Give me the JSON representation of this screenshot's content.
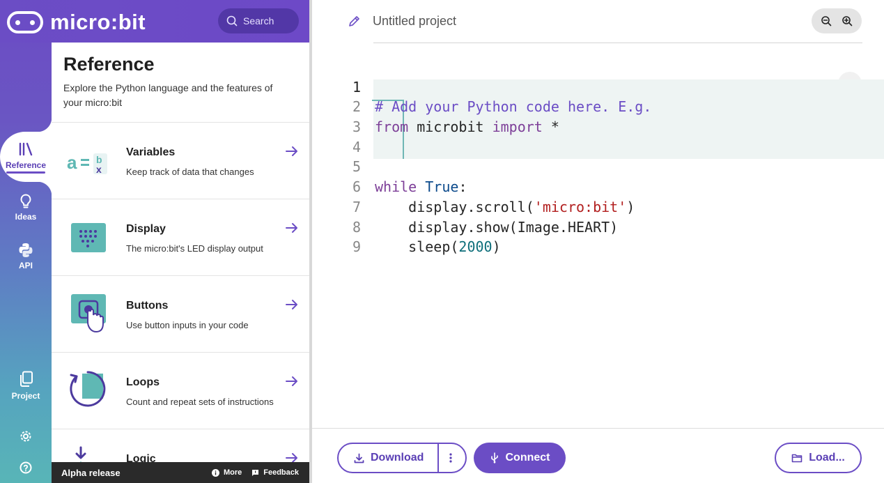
{
  "app": {
    "brand": "micro:bit"
  },
  "search": {
    "label": "Search"
  },
  "nav": {
    "items": [
      {
        "label": "Reference",
        "icon": "library-icon",
        "active": true
      },
      {
        "label": "Ideas",
        "icon": "lightbulb-icon"
      },
      {
        "label": "API",
        "icon": "python-icon"
      },
      {
        "label": "Project",
        "icon": "files-icon"
      }
    ],
    "settings_icon": "gear-icon",
    "help_icon": "help-circle-icon"
  },
  "reference": {
    "title": "Reference",
    "subtitle": "Explore the Python language and the features of your micro:bit",
    "items": [
      {
        "name": "Variables",
        "desc": "Keep track of data that changes"
      },
      {
        "name": "Display",
        "desc": "The micro:bit's LED display output"
      },
      {
        "name": "Buttons",
        "desc": "Use button inputs in your code"
      },
      {
        "name": "Loops",
        "desc": "Count and repeat sets of instructions"
      },
      {
        "name": "Logic",
        "desc": ""
      }
    ]
  },
  "footer": {
    "release": "Alpha release",
    "more": "More",
    "feedback": "Feedback"
  },
  "editor": {
    "project_name": "Untitled project",
    "current_line": 1,
    "line_numbers": [
      "1",
      "2",
      "3",
      "4",
      "5",
      "6",
      "7",
      "8",
      "9"
    ]
  },
  "code": {
    "l1": "# Add your Python code here. E.g.",
    "l2_kw1": "from",
    "l2_mid": " microbit ",
    "l2_kw2": "import",
    "l2_end": " *",
    "l5_kw": "while",
    "l5_true": "True",
    "l5_end": ":",
    "l6_a": "    display.scroll(",
    "l6_str": "'micro:bit'",
    "l6_b": ")",
    "l7": "    display.show(Image.HEART)",
    "l8_a": "    sleep(",
    "l8_num": "2000",
    "l8_b": ")"
  },
  "actions": {
    "download": "Download",
    "connect": "Connect",
    "load": "Load..."
  },
  "colors": {
    "brand": "#6b4dc5",
    "teal": "#5fb8b4",
    "footer_bg": "#2a2a2a"
  }
}
